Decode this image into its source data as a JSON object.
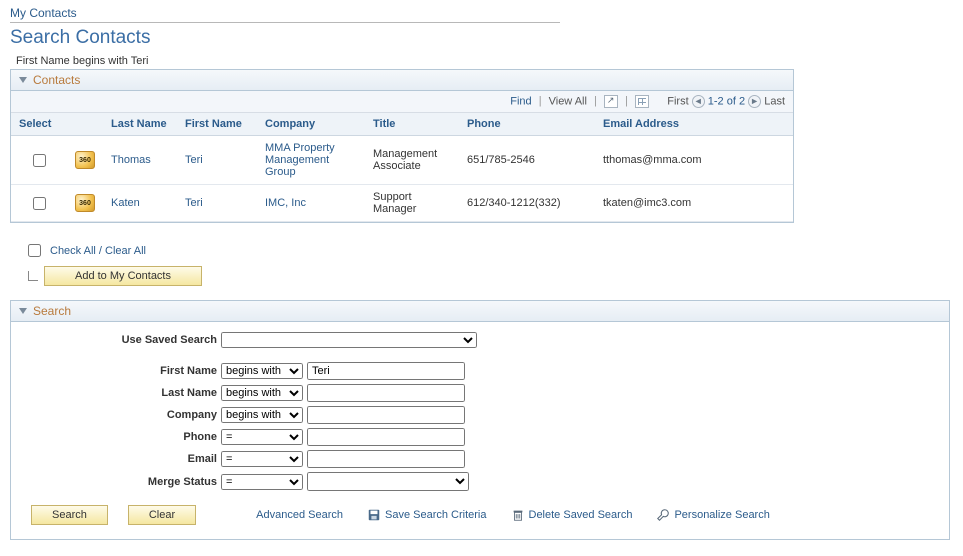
{
  "breadcrumb": "My Contacts",
  "page_title": "Search Contacts",
  "criteria_summary": "First Name begins with Teri",
  "contacts_section": {
    "title": "Contacts",
    "nav": {
      "find": "Find",
      "view_all": "View All",
      "first": "First",
      "range": "1-2 of 2",
      "last": "Last"
    },
    "columns": {
      "select": "Select",
      "last_name": "Last Name",
      "first_name": "First Name",
      "company": "Company",
      "title": "Title",
      "phone": "Phone",
      "email": "Email Address"
    },
    "rows": [
      {
        "icon_label": "360",
        "last_name": "Thomas",
        "first_name": "Teri",
        "company": "MMA Property Management Group",
        "title": "Management Associate",
        "phone": "651/785-2546",
        "email": "tthomas@mma.com"
      },
      {
        "icon_label": "360",
        "last_name": "Katen",
        "first_name": "Teri",
        "company": "IMC, Inc",
        "title": "Support Manager",
        "phone": "612/340-1212(332)",
        "email": "tkaten@imc3.com"
      }
    ],
    "check_all": "Check All / Clear All",
    "add_button": "Add to My Contacts"
  },
  "search_section": {
    "title": "Search",
    "use_saved_label": "Use Saved Search",
    "fields": {
      "first_name": {
        "label": "First Name",
        "op": "begins with",
        "value": "Teri"
      },
      "last_name": {
        "label": "Last Name",
        "op": "begins with",
        "value": ""
      },
      "company": {
        "label": "Company",
        "op": "begins with",
        "value": ""
      },
      "phone": {
        "label": "Phone",
        "op": "=",
        "value": ""
      },
      "email": {
        "label": "Email",
        "op": "=",
        "value": ""
      },
      "merge": {
        "label": "Merge Status",
        "op": "=",
        "value": ""
      }
    },
    "buttons": {
      "search": "Search",
      "clear": "Clear"
    },
    "links": {
      "advanced": "Advanced Search",
      "save_criteria": "Save Search Criteria",
      "delete_saved": "Delete Saved Search",
      "personalize": "Personalize Search"
    }
  }
}
